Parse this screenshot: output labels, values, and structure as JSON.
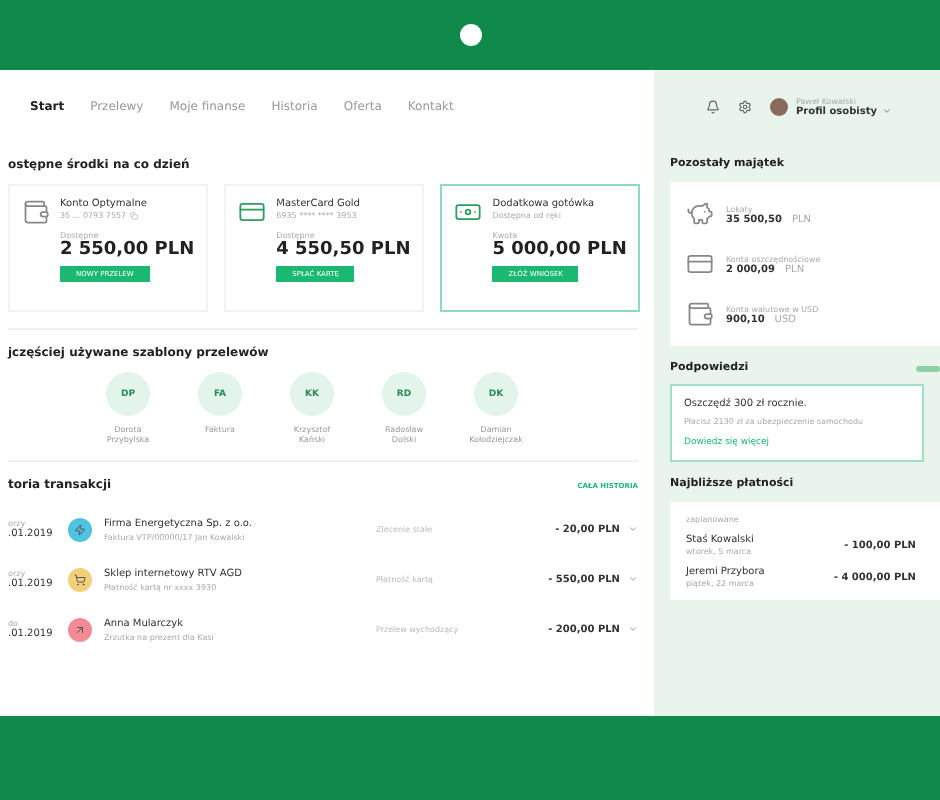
{
  "nav": [
    {
      "label": "Start",
      "selected": true
    },
    {
      "label": "Przelewy",
      "selected": false
    },
    {
      "label": "Moje finanse",
      "selected": false
    },
    {
      "label": "Historia",
      "selected": false
    },
    {
      "label": "Oferta",
      "selected": false
    },
    {
      "label": "Kontakt",
      "selected": false
    }
  ],
  "user": {
    "name": "Paweł Kowalski",
    "profile": "Profil osobisty"
  },
  "accounts": {
    "title": "ostępne środki na co dzień",
    "items": [
      {
        "kind": "wallet",
        "name": "Konto Optymalne",
        "number": "35 ... 0793 7557",
        "label": "Dostępne",
        "amount": "2 550,00 PLN",
        "action": "NOWY PRZELEW",
        "highlighted": false
      },
      {
        "kind": "card",
        "name": "MasterCard Gold",
        "number": "6935 **** **** 3953",
        "label": "Dostępne",
        "amount": "4 550,50 PLN",
        "action": "SPŁAĆ KARTĘ",
        "highlighted": false
      },
      {
        "kind": "cash",
        "name": "Dodatkowa gotówka",
        "number": "Dostępna od ręki",
        "label": "Kwota",
        "amount": "5 000,00 PLN",
        "action": "ZŁÓŻ WNIOSEK",
        "highlighted": true
      }
    ]
  },
  "templates": {
    "title": "jczęściej używane szablony przelewów",
    "items": [
      {
        "initials": "DP",
        "name": "Dorota Przybylska"
      },
      {
        "initials": "FA",
        "name": "Faktura"
      },
      {
        "initials": "KK",
        "name": "Krzysztof Kański"
      },
      {
        "initials": "RD",
        "name": "Radosław Dolski"
      },
      {
        "initials": "DK",
        "name": "Damian Kołodziejczak"
      }
    ]
  },
  "history": {
    "title": "toria transakcji",
    "link": "CAŁA HISTORIA",
    "rows": [
      {
        "day": "orzy",
        "date": ".01.2019",
        "kind": "energy",
        "color": "#4fc3e0",
        "name": "Firma Energetyczna Sp. z o.o.",
        "detail": "Faktura VTP/00000/17 Jan Kowalski",
        "type": "Zlecenie stałe",
        "amount": "- 20,00 PLN"
      },
      {
        "day": "orzy",
        "date": ".01.2019",
        "kind": "card",
        "color": "#f3cf7a",
        "name": "Sklep internetowy RTV AGD",
        "detail": "Płatność kartą nr xxxx 3930",
        "type": "Płatność kartą",
        "amount": "- 550,00 PLN"
      },
      {
        "day": "do",
        "date": ".01.2019",
        "kind": "transfer",
        "color": "#f28b96",
        "name": "Anna Mularczyk",
        "detail": "Zrzutka na prezent dla Kasi",
        "type": "Przelew wychodzący",
        "amount": "- 200,00 PLN"
      }
    ]
  },
  "assets": {
    "title": "Pozostały majątek",
    "items": [
      {
        "kind": "piggy",
        "name": "Lokaty",
        "amount": "35 500,50",
        "currency": "PLN"
      },
      {
        "kind": "savings",
        "name": "Konta oszczędnościowe",
        "amount": "2 000,09",
        "currency": "PLN"
      },
      {
        "kind": "wallet",
        "name": "Konta walutowe w USD",
        "amount": "900,10",
        "currency": "USD"
      }
    ]
  },
  "tips": {
    "title": "Podpowiedzi",
    "headline": "Oszczędź 300 zł rocznie.",
    "text": "Płacisz 2130 zł za ubezpieczenie samochodu",
    "link": "Dowiedz się więcej"
  },
  "payments": {
    "title": "Najbliższe płatności",
    "group": "zaplanowane",
    "items": [
      {
        "name": "Staś Kowalski",
        "date": "wtorek, 5 marca",
        "amount": "- 100,00 PLN"
      },
      {
        "name": "Jeremi Przybora",
        "date": "piątek, 22 marca",
        "amount": "- 4 000,00 PLN"
      }
    ]
  }
}
